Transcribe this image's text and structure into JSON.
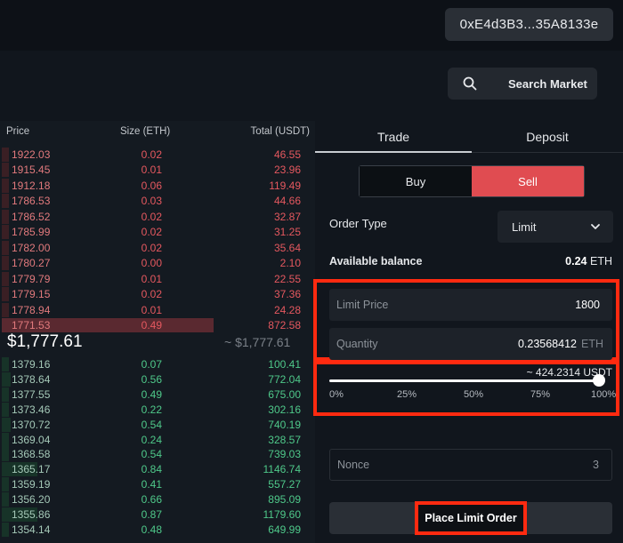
{
  "header": {
    "wallet_address": "0xE4d3B3...35A8133e"
  },
  "search": {
    "label": "Search Market"
  },
  "orderbook": {
    "columns": {
      "price": "Price",
      "size": "Size (ETH)",
      "total": "Total (USDT)"
    },
    "asks": [
      {
        "price": "1922.03",
        "size": "0.02",
        "total": "46.55"
      },
      {
        "price": "1915.45",
        "size": "0.01",
        "total": "23.96"
      },
      {
        "price": "1912.18",
        "size": "0.06",
        "total": "119.49"
      },
      {
        "price": "1786.53",
        "size": "0.03",
        "total": "44.66"
      },
      {
        "price": "1786.52",
        "size": "0.02",
        "total": "32.87"
      },
      {
        "price": "1785.99",
        "size": "0.02",
        "total": "31.25"
      },
      {
        "price": "1782.00",
        "size": "0.02",
        "total": "35.64"
      },
      {
        "price": "1780.27",
        "size": "0.00",
        "total": "2.10"
      },
      {
        "price": "1779.79",
        "size": "0.01",
        "total": "22.55"
      },
      {
        "price": "1779.15",
        "size": "0.02",
        "total": "37.36"
      },
      {
        "price": "1778.94",
        "size": "0.01",
        "total": "24.28"
      },
      {
        "price": "1771.53",
        "size": "0.49",
        "total": "872.58"
      }
    ],
    "mid_price": "$1,777.61",
    "mid_price_secondary": "~ $1,777.61",
    "bids": [
      {
        "price": "1379.16",
        "size": "0.07",
        "total": "100.41"
      },
      {
        "price": "1378.64",
        "size": "0.56",
        "total": "772.04"
      },
      {
        "price": "1377.55",
        "size": "0.49",
        "total": "675.00"
      },
      {
        "price": "1373.46",
        "size": "0.22",
        "total": "302.16"
      },
      {
        "price": "1370.72",
        "size": "0.54",
        "total": "740.19"
      },
      {
        "price": "1369.04",
        "size": "0.24",
        "total": "328.57"
      },
      {
        "price": "1368.58",
        "size": "0.54",
        "total": "739.03"
      },
      {
        "price": "1365.17",
        "size": "0.84",
        "total": "1146.74"
      },
      {
        "price": "1359.19",
        "size": "0.41",
        "total": "557.27"
      },
      {
        "price": "1356.20",
        "size": "0.66",
        "total": "895.09"
      },
      {
        "price": "1355.86",
        "size": "0.87",
        "total": "1179.60"
      },
      {
        "price": "1354.14",
        "size": "0.48",
        "total": "649.99"
      }
    ]
  },
  "panel": {
    "tabs": [
      "Trade",
      "Deposit"
    ],
    "side": {
      "buy": "Buy",
      "sell": "Sell",
      "selected": "Sell"
    },
    "order_type_label": "Order Type",
    "order_type_value": "Limit",
    "balance_label": "Available balance",
    "balance_amount": "0.24",
    "balance_unit": "ETH",
    "limit_price_label": "Limit Price",
    "limit_price_value": "1800",
    "quantity_label": "Quantity",
    "quantity_value": "0.23568412",
    "quantity_unit": "ETH",
    "approx_total": "~ 424.2314 USDT",
    "slider_ticks": [
      "0%",
      "25%",
      "50%",
      "75%",
      "100%"
    ],
    "slider_value_percent": 100,
    "nonce_label": "Nonce",
    "nonce_value": "3",
    "submit_label": "Place Limit Order"
  },
  "colors": {
    "ask": "#e5585f",
    "bid": "#4fc98a",
    "sell_button": "#e04c51",
    "highlight_box": "#ff2a10"
  }
}
